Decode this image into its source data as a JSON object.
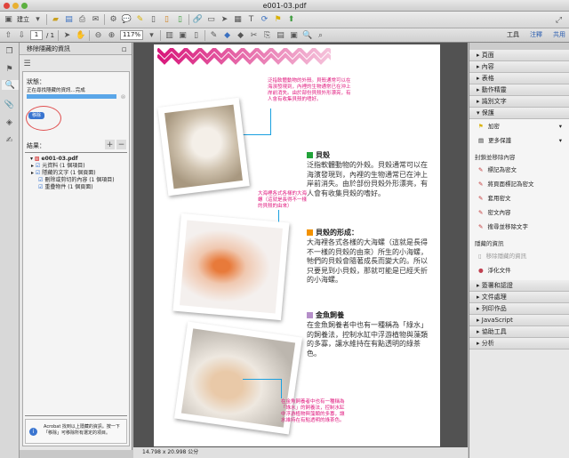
{
  "window": {
    "title": "e001-03.pdf"
  },
  "toolbar1": {
    "create_label": "建立"
  },
  "toolbar2": {
    "page_current": "1",
    "page_total": "/ 1",
    "zoom": "117%"
  },
  "right_tabs": [
    "工具",
    "注釋",
    "共用"
  ],
  "left_panel": {
    "title": "移除隱藏的資訊",
    "status_label": "狀態：",
    "status_text": "正在尋找隱藏的資訊...完成",
    "progress": 100,
    "remove_button": "移除",
    "results_label": "結果：",
    "tree": {
      "file": "e001-03.pdf",
      "items": [
        "元資料 (1 個項目)",
        "隱藏的文字 (1 個頁面)",
        "刪除或剪切的內容 (1 個項目)",
        "重疊物件 (1 個頁面)"
      ]
    },
    "info": "Acrobat 找到以上隱藏的資訊。按一下「移除」可移除所有選定的項目。"
  },
  "status_bar": {
    "dimensions": "14.798 x 20.998 公分"
  },
  "right_panel": {
    "sections_top": [
      "頁面",
      "內容",
      "表格",
      "動作精靈",
      "識別文字"
    ],
    "open_section": "保護",
    "items_a": [
      "加密",
      "更多保護"
    ],
    "group1": "封鎖並移除內容",
    "items_b": [
      "標記為密文",
      "將頁面標記為密文",
      "套用密文",
      "密文內容",
      "搜尋並移除文字"
    ],
    "group2": "隱藏的資訊",
    "items_c": [
      "移除隱藏的資訊",
      "淨化文件"
    ],
    "sections_bottom": [
      "簽署和認證",
      "文件處理",
      "列印作品",
      "JavaScript",
      "協助工具",
      "分析"
    ]
  },
  "document": {
    "note1": "泛指軟體動物的外殼。貝殼通常可以在海濱發現到，內裡的生物通常已在沖上岸前消失。由於部份貝殼外形漂亮，有人會有收集貝殼的嗜好。",
    "note2": "大海裡各式各樣的大海螺（這就是長得不一樣的貝殼的由來）",
    "note3": "在金魚飼養者中也有一種稱為「綠水」的飼養法，控制水缸中浮游植物與藻類的多寡，讓水維持在有點透明的綠茶色。",
    "sections": [
      {
        "heading": "貝殼",
        "color": "#22a33a",
        "text": "泛指軟體動物的外殼。貝殼通常可以在海濱發現到，內裡的生物通常已在沖上岸前消失。由於部份貝殼外形漂亮，有人會有收集貝殼的嗜好。"
      },
      {
        "heading": "貝殼的形成：",
        "color": "#f39200",
        "text": "大海裡各式各樣的大海螺（這就是長得不一樣的貝殼的由來）所生的小海螺，牠們的貝殼會隨著成長而變大的。所以只要見到小貝殼，那就可能是已經夭折的小海螺。"
      },
      {
        "heading": "金魚飼養",
        "color": "#b58fc9",
        "text": "在金魚飼養者中也有一種稱為「綠水」的飼養法，控制水缸中浮游植物與藻類的多寡，讓水維持在有點透明的綠茶色。"
      }
    ]
  }
}
